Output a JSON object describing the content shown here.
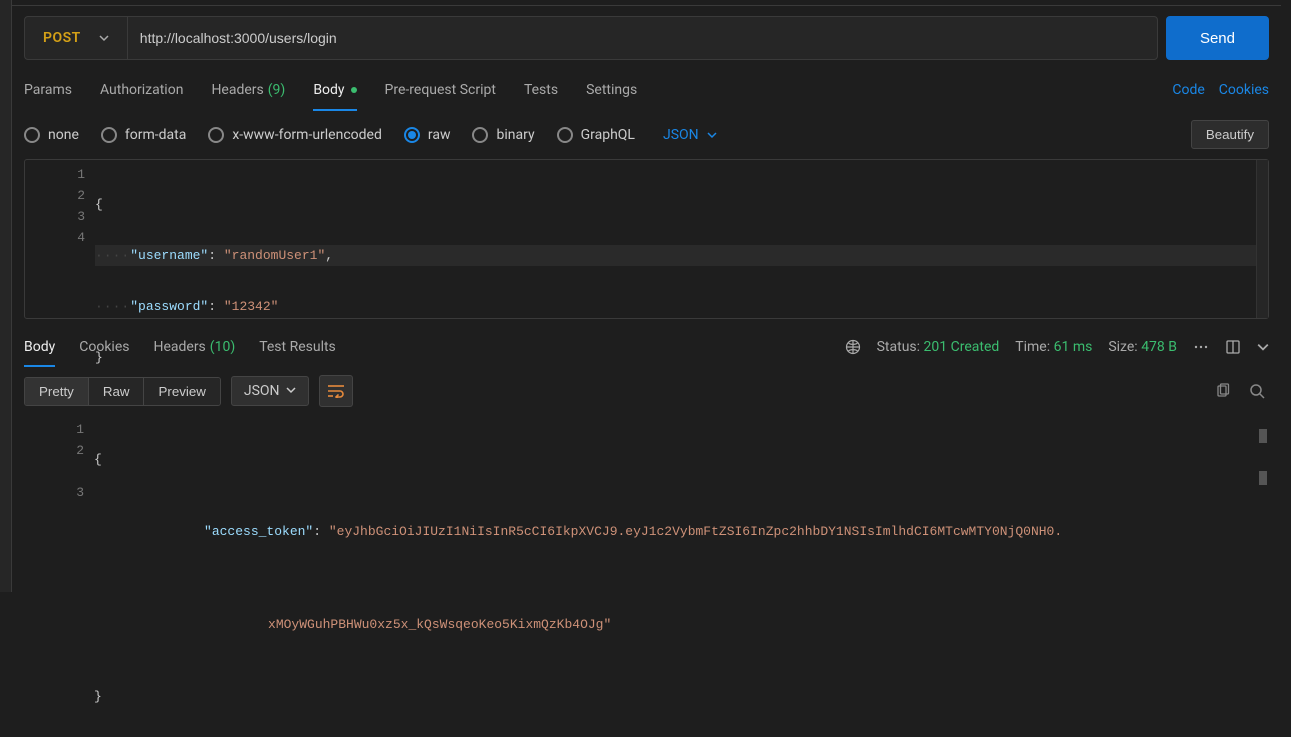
{
  "request": {
    "method": "POST",
    "url": "http://localhost:3000/users/login",
    "send_label": "Send"
  },
  "tabs": {
    "params": "Params",
    "authorization": "Authorization",
    "headers_label": "Headers",
    "headers_count": "(9)",
    "body": "Body",
    "prerequest": "Pre-request Script",
    "tests": "Tests",
    "settings": "Settings",
    "code": "Code",
    "cookies": "Cookies"
  },
  "body_types": {
    "none": "none",
    "formdata": "form-data",
    "urlencoded": "x-www-form-urlencoded",
    "raw": "raw",
    "binary": "binary",
    "graphql": "GraphQL",
    "format": "JSON",
    "beautify": "Beautify"
  },
  "req_body": {
    "line_numbers": [
      "1",
      "2",
      "3",
      "4"
    ],
    "open_brace": "{",
    "key1": "\"username\"",
    "val1": "\"randomUser1\"",
    "key2": "\"password\"",
    "val2": "\"12342\"",
    "close_brace": "}",
    "indent_dots": "····"
  },
  "response": {
    "tabs": {
      "body": "Body",
      "cookies": "Cookies",
      "headers_label": "Headers",
      "headers_count": "(10)",
      "test_results": "Test Results"
    },
    "status_label": "Status:",
    "status_value": "201 Created",
    "time_label": "Time:",
    "time_value": "61 ms",
    "size_label": "Size:",
    "size_value": "478 B",
    "views": {
      "pretty": "Pretty",
      "raw": "Raw",
      "preview": "Preview",
      "format": "JSON"
    },
    "body": {
      "line_numbers": [
        "1",
        "2",
        "3"
      ],
      "open_brace": "{",
      "key": "\"access_token\"",
      "value_part1": "\"eyJhbGciOiJIUzI1NiIsInR5cCI6IkpXVCJ9.eyJ1c2VybmFtZSI6InZpc2hhbDY1NSIsImlhdCI6MTcwMTY0NjQ0NH0.",
      "value_part2": "xMOyWGuhPBHWu0xz5x_kQsWsqeoKeo5KixmQzKb4OJg\"",
      "close_brace": "}"
    }
  }
}
